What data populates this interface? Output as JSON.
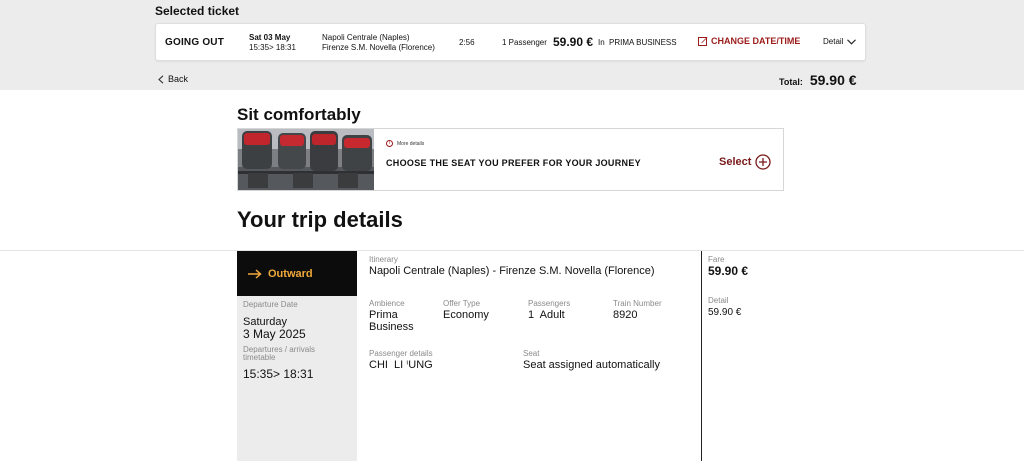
{
  "header": {
    "title": "Selected ticket",
    "ticket": {
      "direction": "GOING OUT",
      "date": "Sat 03 May",
      "times": "15:35> 18:31",
      "origin": "Napoli Centrale (Naples)",
      "destination": "Firenze S.M. Novella (Florence)",
      "duration": "2:56",
      "passengers": "1 Passenger",
      "price": "59.90 €",
      "in_label": "In",
      "class_name": "PRIMA BUSINESS",
      "change_label": "CHANGE DATE/TIME",
      "detail_label": "Detail"
    },
    "back_label": "Back",
    "total_label": "Total:",
    "total_value": "59.90 €"
  },
  "seat_section": {
    "title": "Sit comfortably",
    "more_details": "More details",
    "cta": "CHOOSE THE SEAT YOU PREFER FOR YOUR JOURNEY",
    "select_label": "Select"
  },
  "trip": {
    "title": "Your trip details",
    "outward_label": "Outward",
    "departure_date_label": "Departure Date",
    "departure_day": "Saturday",
    "departure_date": "3 May 2025",
    "timetable_label": "Departures / arrivals timetable",
    "timetable": "15:35> 18:31",
    "itinerary_label": "Itinerary",
    "itinerary": "Napoli Centrale (Naples) - Firenze S.M. Novella (Florence)",
    "ambience_label": "Ambience",
    "ambience": "Prima Business",
    "offer_label": "Offer Type",
    "offer": "Economy",
    "passengers_label": "Passengers",
    "passengers": "1  Adult",
    "train_label": "Train Number",
    "train": "8920",
    "passenger_details_label": "Passenger details",
    "passenger_details": "CHI  LI ⁱUNG",
    "seat_label": "Seat",
    "seat": "Seat assigned automatically",
    "fare_label": "Fare",
    "fare": "59.90 €",
    "detail_label": "Detail",
    "detail": "59.90 €"
  },
  "colors": {
    "accent_red": "#9b1b1b",
    "outward_orange": "#f2a93b",
    "band_grey": "#ececec"
  },
  "icons": [
    "edit-icon",
    "chevron-down-icon",
    "chevron-left-icon",
    "info-icon",
    "plus-circle-icon",
    "arrow-right-icon"
  ]
}
